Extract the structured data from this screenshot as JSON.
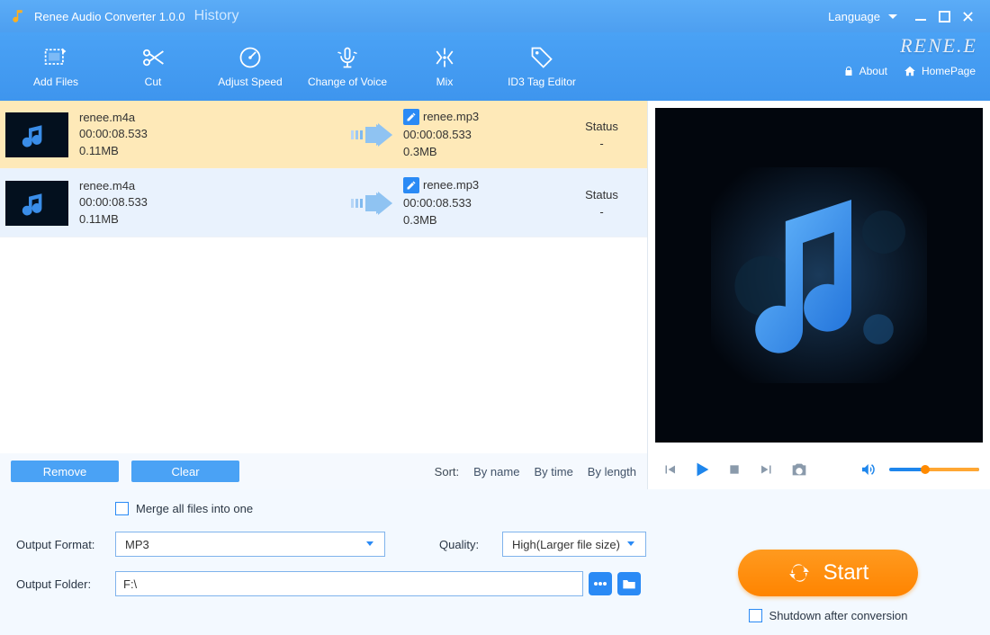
{
  "titlebar": {
    "app_title": "Renee Audio Converter 1.0.0",
    "history": "History",
    "language_label": "Language"
  },
  "toolbar": {
    "items": [
      {
        "label": "Add Files",
        "icon": "film-add"
      },
      {
        "label": "Cut",
        "icon": "scissors"
      },
      {
        "label": "Adjust Speed",
        "icon": "speedometer"
      },
      {
        "label": "Change of Voice",
        "icon": "microphone"
      },
      {
        "label": "Mix",
        "icon": "mixer"
      },
      {
        "label": "ID3 Tag Editor",
        "icon": "tag"
      }
    ],
    "logo_text": "RENE.E",
    "about": "About",
    "homepage": "HomePage"
  },
  "files": [
    {
      "src_name": "renee.m4a",
      "src_duration": "00:00:08.533",
      "src_size": "0.11MB",
      "out_name": "renee.mp3",
      "out_duration": "00:00:08.533",
      "out_size": "0.3MB",
      "status_label": "Status",
      "status_value": "-",
      "selected": true
    },
    {
      "src_name": "renee.m4a",
      "src_duration": "00:00:08.533",
      "src_size": "0.11MB",
      "out_name": "renee.mp3",
      "out_duration": "00:00:08.533",
      "out_size": "0.3MB",
      "status_label": "Status",
      "status_value": "-",
      "selected": false
    }
  ],
  "list_actions": {
    "remove": "Remove",
    "clear": "Clear",
    "sort_label": "Sort:",
    "by_name": "By name",
    "by_time": "By time",
    "by_length": "By length"
  },
  "settings": {
    "merge_label": "Merge all files into one",
    "output_format_label": "Output Format:",
    "output_format_value": "MP3",
    "quality_label": "Quality:",
    "quality_value": "High(Larger file size)",
    "output_folder_label": "Output Folder:",
    "output_folder_value": "F:\\"
  },
  "start": {
    "label": "Start",
    "shutdown_label": "Shutdown after conversion"
  }
}
